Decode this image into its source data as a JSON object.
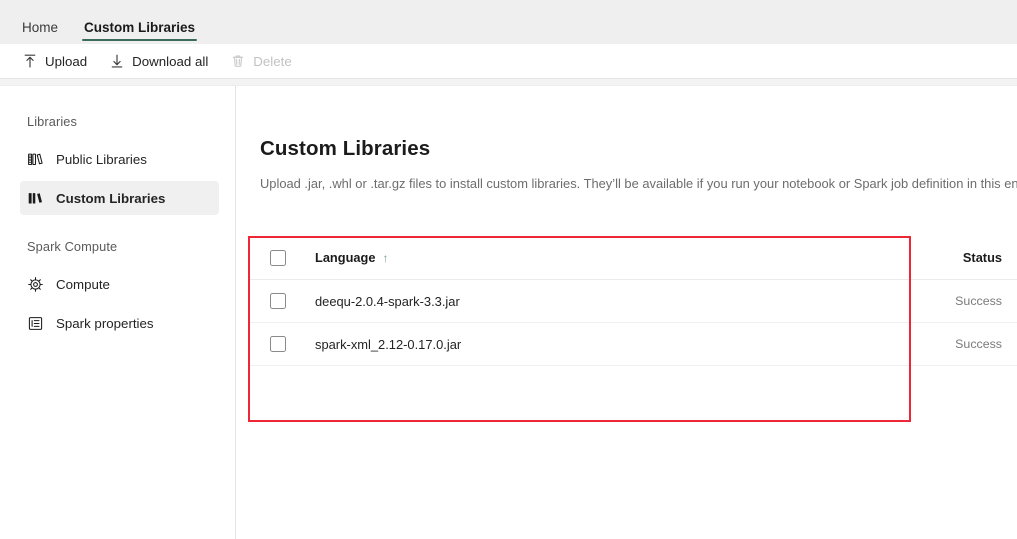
{
  "tabs": [
    {
      "label": "Home",
      "active": false
    },
    {
      "label": "Custom Libraries",
      "active": true
    }
  ],
  "toolbar": {
    "upload_label": "Upload",
    "download_all_label": "Download all",
    "delete_label": "Delete",
    "upload_icon": "upload-arrow-icon",
    "download_icon": "download-arrow-icon",
    "delete_icon": "trash-icon"
  },
  "sidebar": {
    "sections": [
      {
        "title": "Libraries",
        "items": [
          {
            "label": "Public Libraries",
            "icon": "public-library-icon",
            "selected": false
          },
          {
            "label": "Custom Libraries",
            "icon": "custom-library-icon",
            "selected": true
          }
        ]
      },
      {
        "title": "Spark Compute",
        "items": [
          {
            "label": "Compute",
            "icon": "compute-chip-icon",
            "selected": false
          },
          {
            "label": "Spark properties",
            "icon": "properties-list-icon",
            "selected": false
          }
        ]
      }
    ]
  },
  "main": {
    "title": "Custom Libraries",
    "description": "Upload .jar, .whl or .tar.gz files to install custom libraries. They’ll be available if you run your notebook or Spark job definition in this environment",
    "table": {
      "columns": {
        "language": "Language",
        "status": "Status"
      },
      "sort_indicator": "↑",
      "rows": [
        {
          "name": "deequ-2.0.4-spark-3.3.jar",
          "status": "Success",
          "checked": false
        },
        {
          "name": "spark-xml_2.12-0.17.0.jar",
          "status": "Success",
          "checked": false
        }
      ]
    }
  },
  "annotation": {
    "color": "#ee2737"
  }
}
